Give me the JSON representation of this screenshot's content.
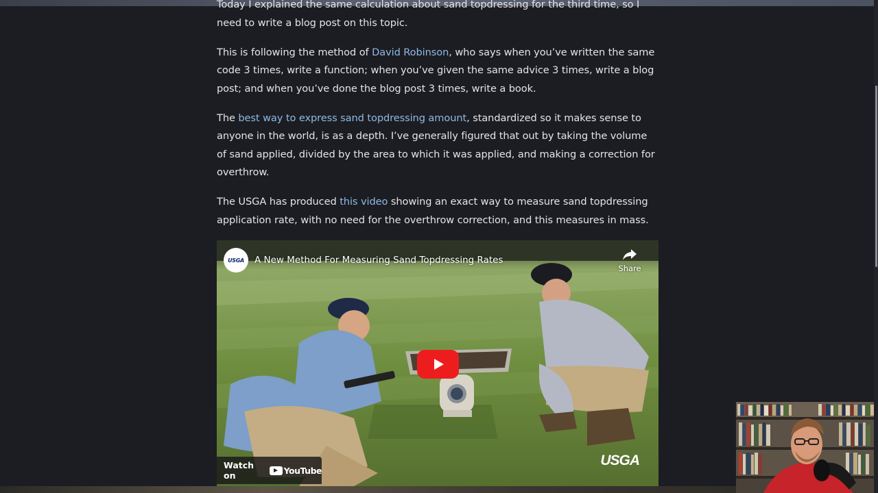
{
  "article": {
    "p0": {
      "text": "Today I explained the same calculation about sand topdressing for the third time, so I need to write a blog post on this topic."
    },
    "p1": {
      "t1": "This is following the method of ",
      "link": "David Robinson",
      "t2": ", who says when you’ve written the same code 3 times, write a function; when you’ve given the same advice 3 times, write a blog post; and when you’ve done the blog post 3 times, write a book."
    },
    "p2": {
      "t1": "The ",
      "link": "best way to express sand topdressing amount",
      "t2": ", standardized so it makes sense to anyone in the world, is as a depth. I’ve generally figured that out by taking the volume of sand applied, divided by the area to which it was applied, and making a correction for overthrow."
    },
    "p3": {
      "t1": "The USGA has produced ",
      "link": "this video",
      "t2": " showing an exact way to measure sand topdressing application rate, with no need for the overthrow correction, and this measures in mass."
    }
  },
  "video": {
    "channel_logo_text": "USGA",
    "title": "A New Method For Measuring Sand Topdressing Rates",
    "share_label": "Share",
    "share_icon": "share-arrow-icon",
    "play_icon": "play-icon",
    "watch_label": "Watch on",
    "youtube_label": "YouTube",
    "watermark": "USGA"
  },
  "colors": {
    "background": "#1c1d22",
    "link": "#8fb8e4",
    "text": "#e4e4e6",
    "play_button": "#ee1d1d"
  }
}
